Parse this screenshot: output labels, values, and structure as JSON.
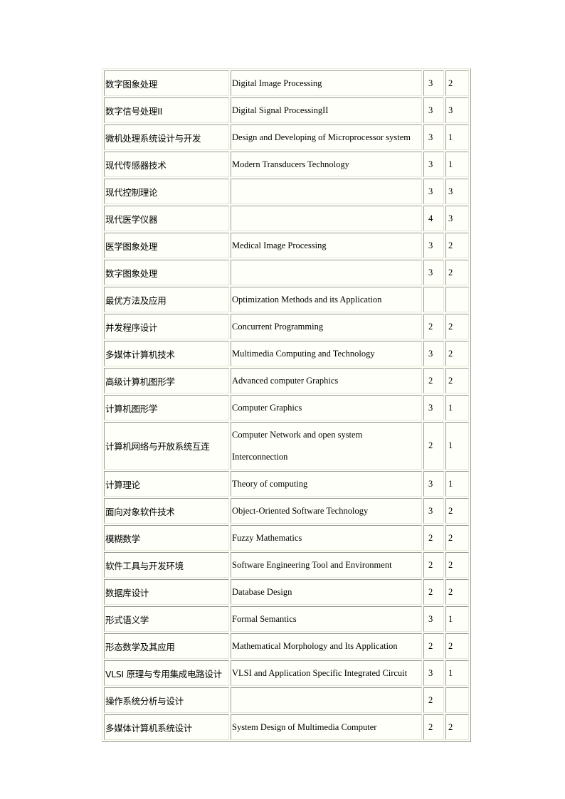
{
  "table": {
    "rows": [
      {
        "cn": "数字图象处理",
        "en": "Digital Image Processing",
        "a": "3",
        "b": "2"
      },
      {
        "cn": "数字信号处理II",
        "en": "Digital Signal ProcessingII",
        "a": "3",
        "b": "3"
      },
      {
        "cn": "微机处理系统设计与开发",
        "en": "Design and Developing of Microprocessor system",
        "a": "3",
        "b": "1"
      },
      {
        "cn": "现代传感器技术",
        "en": "Modern Transducers Technology",
        "a": "3",
        "b": "1"
      },
      {
        "cn": "现代控制理论",
        "en": "",
        "a": "3",
        "b": "3"
      },
      {
        "cn": "现代医学仪器",
        "en": "",
        "a": "4",
        "b": "3"
      },
      {
        "cn": "医学图象处理",
        "en": "Medical Image Processing",
        "a": "3",
        "b": "2"
      },
      {
        "cn": "数字图象处理",
        "en": "",
        "a": "3",
        "b": "2"
      },
      {
        "cn": "最优方法及应用",
        "en": "Optimization Methods and its Application",
        "a": "",
        "b": ""
      },
      {
        "cn": "并发程序设计",
        "en": "Concurrent Programming",
        "a": "2",
        "b": "2"
      },
      {
        "cn": "多媒体计算机技术",
        "en": "Multimedia Computing and Technology",
        "a": "3",
        "b": "2"
      },
      {
        "cn": "高级计算机图形学",
        "en": "Advanced computer Graphics",
        "a": "2",
        "b": "2"
      },
      {
        "cn": "计算机图形学",
        "en": "Computer Graphics",
        "a": "3",
        "b": "1"
      },
      {
        "cn": "计算机网络与开放系统互连",
        "en": "Computer Network and open system",
        "en2": "Interconnection",
        "a": "2",
        "b": "1"
      },
      {
        "cn": "计算理论",
        "en": "Theory of computing",
        "a": "3",
        "b": "1"
      },
      {
        "cn": "面向对象软件技术",
        "en": "Object-Oriented Software Technology",
        "a": "3",
        "b": "2"
      },
      {
        "cn": "模糊数学",
        "en": "Fuzzy Mathematics",
        "a": "2",
        "b": "2"
      },
      {
        "cn": "软件工具与开发环境",
        "en": "Software Engineering  Tool and Environment",
        "a": "2",
        "b": "2"
      },
      {
        "cn": "数据库设计",
        "en": "Database Design",
        "a": "2",
        "b": "2"
      },
      {
        "cn": "形式语义学",
        "en": "Formal Semantics",
        "a": "3",
        "b": "1"
      },
      {
        "cn": "形态数学及其应用",
        "en": "Mathematical  Morphology and Its Application",
        "a": "2",
        "b": "2"
      },
      {
        "cn": "VLSI 原理与专用集成电路设计",
        "en": "VLSI and Application  Specific  Integrated  Circuit",
        "a": "3",
        "b": "1"
      },
      {
        "cn": "操作系统分析与设计",
        "en": "",
        "a": "2",
        "b": ""
      },
      {
        "cn": "多媒体计算机系统设计",
        "en": "System Design of Multimedia  Computer",
        "a": "2",
        "b": "2"
      }
    ]
  }
}
